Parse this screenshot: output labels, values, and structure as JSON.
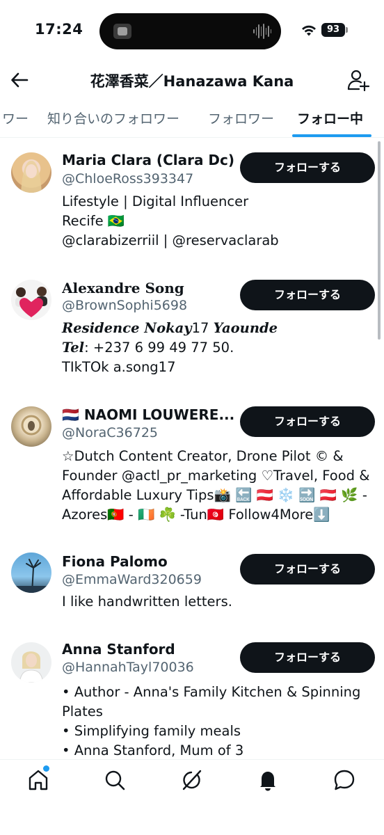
{
  "status": {
    "time": "17:24",
    "battery": "93"
  },
  "header": {
    "title": "花澤香菜／Hanazawa Kana"
  },
  "tabs": [
    {
      "label": "ワー"
    },
    {
      "label": "知り合いのフォロワー"
    },
    {
      "label": "フォロワー"
    },
    {
      "label": "フォロー中",
      "active": true
    }
  ],
  "users": [
    {
      "name": "Maria Clara (Clara Dc)",
      "handle": "@ChloeRoss393347",
      "button": "フォローする",
      "bio": [
        "Lifestyle | Digital Influencer",
        "Recife 🇧🇷",
        "@clarabizerriil | @reservaclarab"
      ]
    },
    {
      "name": "Alexandre Song",
      "handle": "@BrownSophi5698",
      "button": "フォローする",
      "bio_parts": {
        "line1_a": "Residence Nokay",
        "line1_b": "17 ",
        "line1_c": "Yaounde",
        "line2_a": "Tel",
        "line2_b": ": +237 6 99 49 77 50.",
        "line3": "TIkTOk a.song17"
      }
    },
    {
      "name": "🇳🇱 NAOMI LOUWERE...",
      "handle": "@NoraC36725",
      "button": "フォローする",
      "bio": [
        "☆Dutch Content Creator, Drone Pilot © & Founder @actl_pr_marketing ♡Travel, Food & Affordable Luxury Tips📸 🔙 🇦🇹 ❄️ 🔜 🇦🇹 🌿 -Azores🇵🇹 - 🇮🇪 ☘️ -Tun🇹🇳 Follow4More⬇️"
      ]
    },
    {
      "name": "Fiona Palomo",
      "handle": "@EmmaWard320659",
      "button": "フォローする",
      "bio": [
        "I like handwritten letters."
      ]
    },
    {
      "name": "Anna Stanford",
      "handle": "@HannahTayl70036",
      "button": "フォローする",
      "bio": [
        "• Author - Anna's Family Kitchen & Spinning Plates",
        "• Simplifying family meals",
        "• Anna Stanford, Mum of 3"
      ]
    }
  ],
  "bottom_nav": [
    "home-icon",
    "search-icon",
    "grok-icon",
    "notifications-icon",
    "messages-icon"
  ],
  "colors": {
    "accent": "#1d9bf0",
    "button": "#0f1419",
    "secondary_text": "#536471"
  }
}
